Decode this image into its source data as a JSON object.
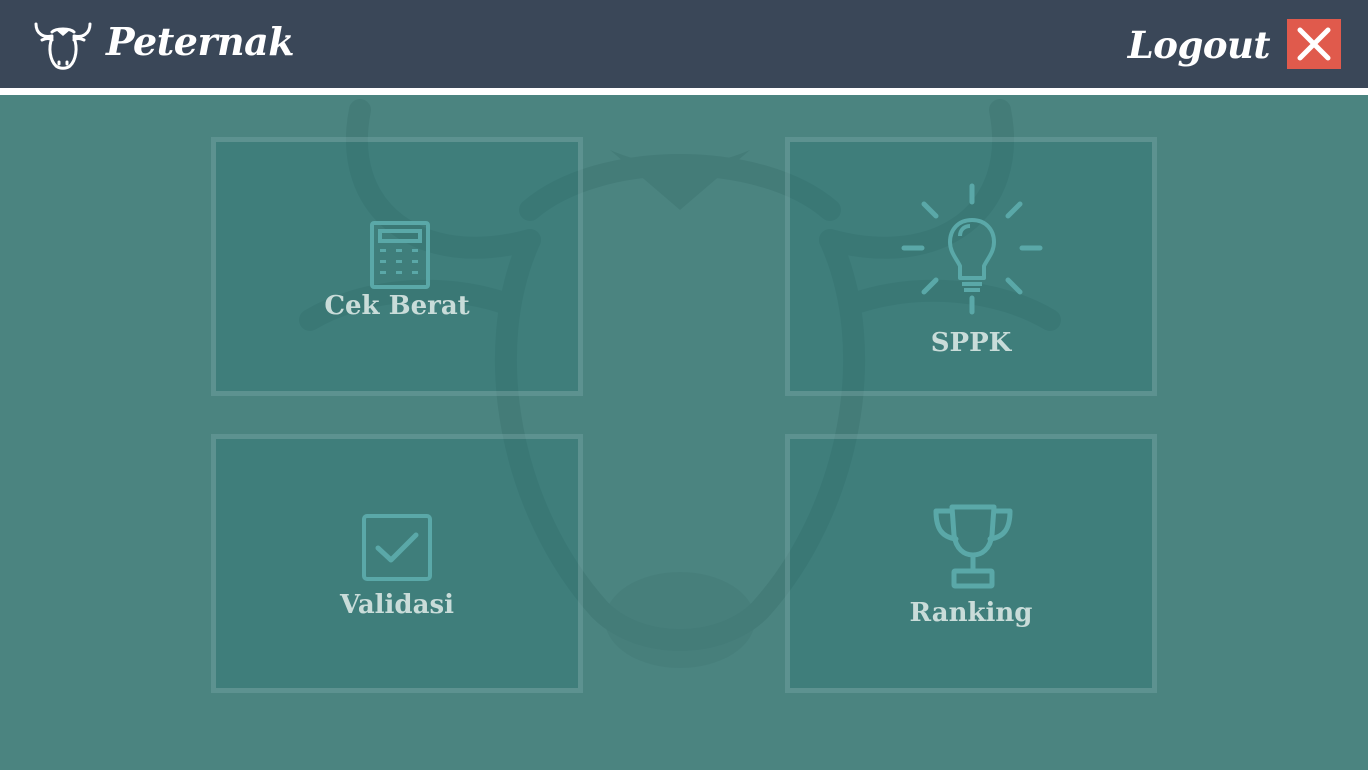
{
  "header": {
    "title": "Peternak",
    "logout_label": "Logout",
    "close_icon": "close-icon",
    "logo_icon": "cow-head-logo-icon"
  },
  "menu": [
    {
      "label": "Cek Berat",
      "icon": "calculator-icon"
    },
    {
      "label": "SPPK",
      "icon": "lightbulb-icon"
    },
    {
      "label": "Validasi",
      "icon": "checkbox-icon"
    },
    {
      "label": "Ranking",
      "icon": "trophy-icon"
    }
  ],
  "colors": {
    "header_bg": "#3a4758",
    "page_bg": "#4b8480",
    "close_bg": "#e05a4c",
    "icon": "#5aa8a8",
    "label": "#c9dcd9"
  }
}
